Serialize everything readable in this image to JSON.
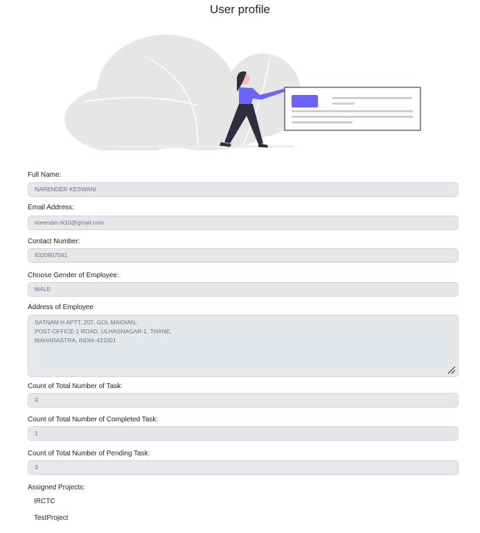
{
  "page": {
    "title": "User profile"
  },
  "form": {
    "full_name": {
      "label": "Full Name:",
      "value": "NARENDER KESWANI"
    },
    "email": {
      "label": "Email Address:",
      "value": "narender.rk10@gmail.com"
    },
    "contact": {
      "label": "Contact Number:",
      "value": "9320907041"
    },
    "gender": {
      "label": "Choose Gender of Employee:",
      "value": "MALE"
    },
    "address": {
      "label": "Address of Employee",
      "value": "SATNAM H APTT, 207, GOL MAIDIAN,\nPOST-OFFICE-1 ROAD, ULHASNAGAR-1, THANE,\nMAHARASTRA, INDIA-421001"
    },
    "total_tasks": {
      "label": "Count of Total Number of Task:",
      "value": "4"
    },
    "completed_tasks": {
      "label": "Count of Total Number of Completed Task:",
      "value": "1"
    },
    "pending_tasks": {
      "label": "Count of Total Number of Pending Task:",
      "value": "3"
    }
  },
  "projects": {
    "label": "Assigned Projects:",
    "items": [
      "IRCTC",
      "TestProject"
    ]
  },
  "colors": {
    "accent": "#6c63ff",
    "field_bg": "#e5e7eb"
  }
}
